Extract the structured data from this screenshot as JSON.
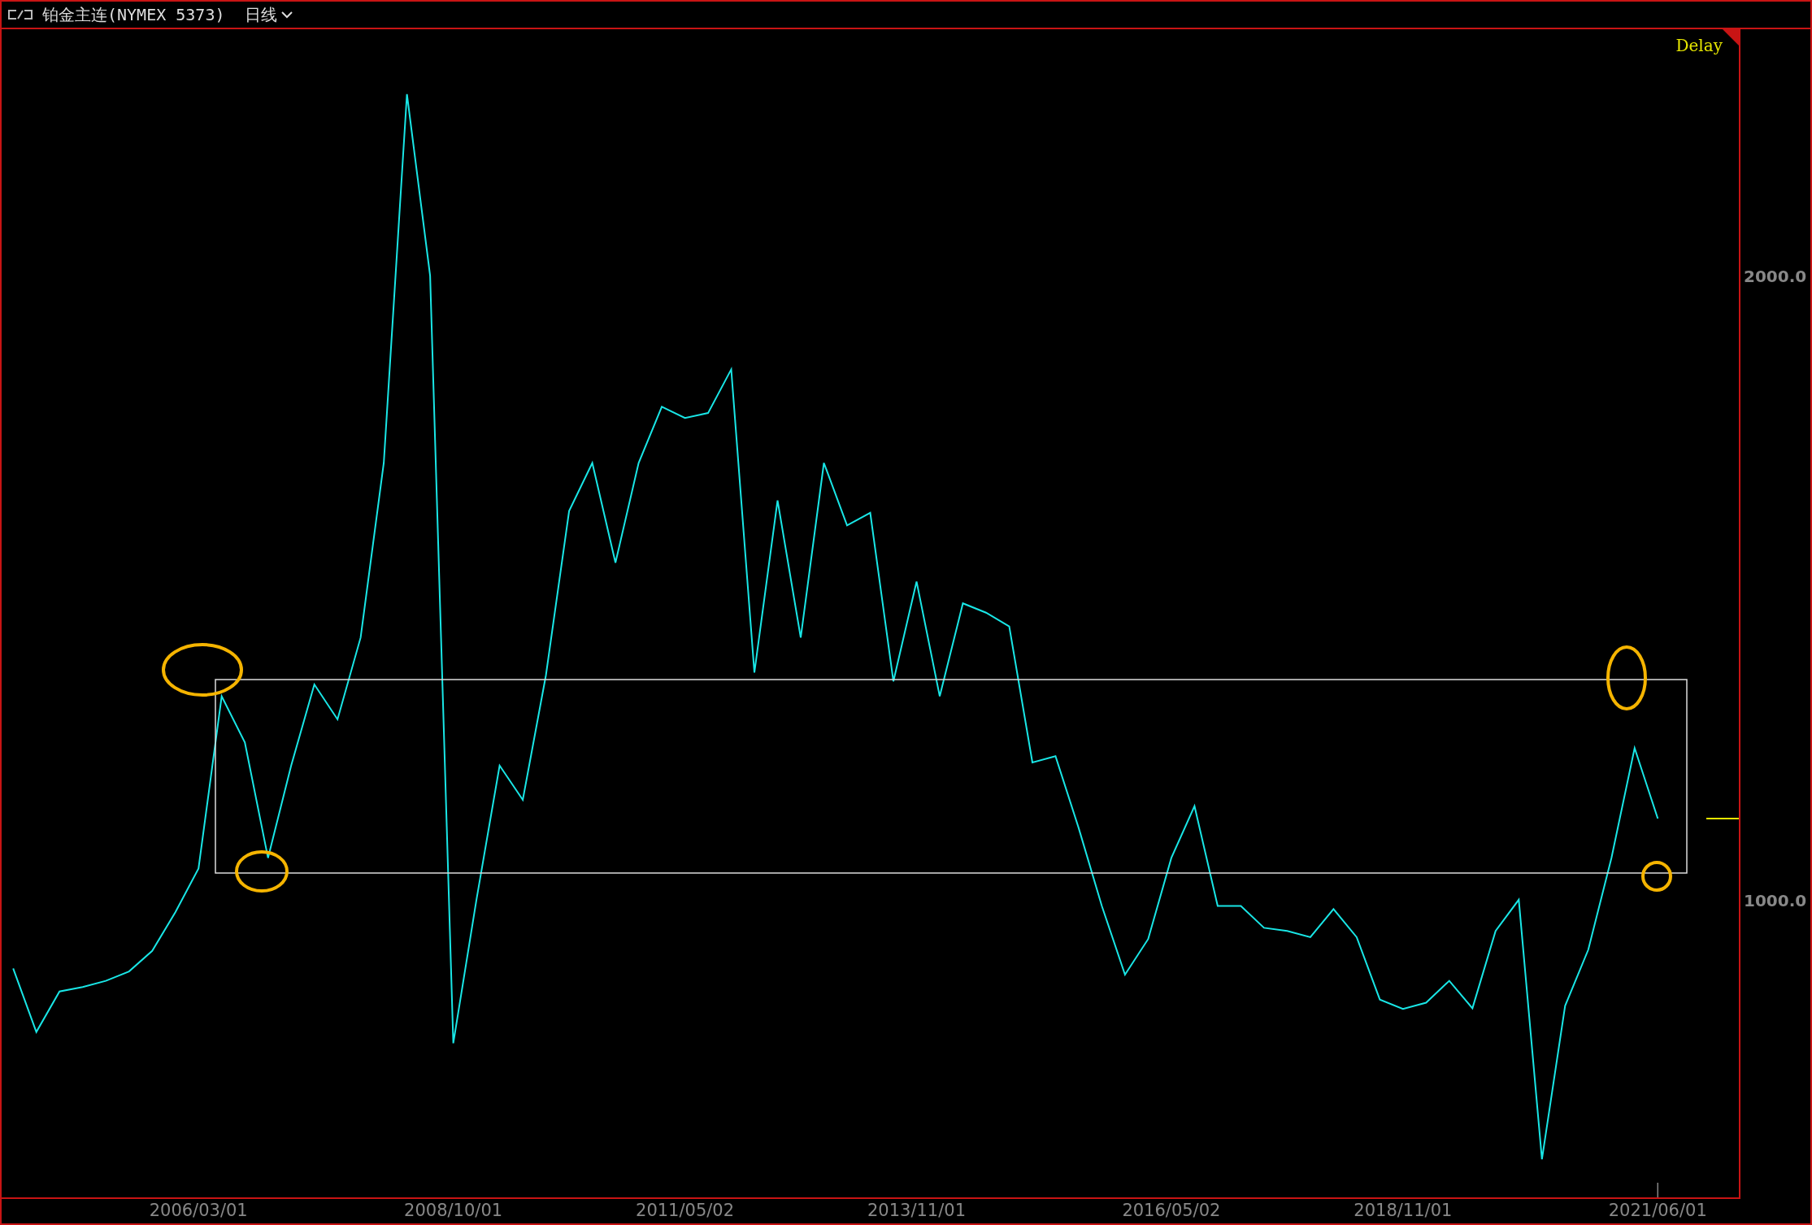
{
  "header": {
    "title": "铂金主连(NYMEX 5373)",
    "period": "日线"
  },
  "status": "Delay",
  "chart_data": {
    "type": "line",
    "ylim": [
      523,
      2395
    ],
    "yticks": [
      {
        "value": 2000,
        "label": "2000.0"
      },
      {
        "value": 1000,
        "label": "1000.0"
      }
    ],
    "categories": [
      null,
      null,
      null,
      null,
      null,
      null,
      null,
      null,
      "2006/03/01",
      null,
      null,
      null,
      null,
      null,
      null,
      null,
      null,
      null,
      null,
      "2008/10/01",
      null,
      null,
      null,
      null,
      null,
      null,
      null,
      null,
      null,
      "2011/05/02",
      null,
      null,
      null,
      null,
      null,
      null,
      null,
      null,
      null,
      "2013/11/01",
      null,
      null,
      null,
      null,
      null,
      null,
      null,
      null,
      null,
      null,
      "2016/05/02",
      null,
      null,
      null,
      null,
      null,
      null,
      null,
      null,
      null,
      "2018/11/01",
      null,
      null,
      null,
      null,
      null,
      null,
      null,
      null,
      null,
      null,
      "2021/06/01",
      null,
      null,
      null
    ],
    "series": [
      {
        "color": "#19e6e6",
        "values": [
          890,
          788,
          853,
          860,
          870,
          885,
          918,
          980,
          1050,
          1326,
          1252,
          1067,
          1215,
          1345,
          1289,
          1420,
          1700,
          2291,
          2000,
          770,
          1000,
          1215,
          1160,
          1360,
          1623,
          1700,
          1540,
          1700,
          1790,
          1772,
          1780,
          1850,
          1364,
          1640,
          1420,
          1700,
          1600,
          1620,
          1350,
          1510,
          1326,
          1475,
          1460,
          1438,
          1220,
          1230,
          1115,
          990,
          880,
          937,
          1067,
          1150,
          990,
          990,
          955,
          950,
          940,
          985,
          940,
          840,
          825,
          835,
          870,
          826,
          950,
          1000,
          584,
          830,
          920,
          1067,
          1243,
          1130,
          null,
          null,
          null
        ]
      }
    ]
  }
}
